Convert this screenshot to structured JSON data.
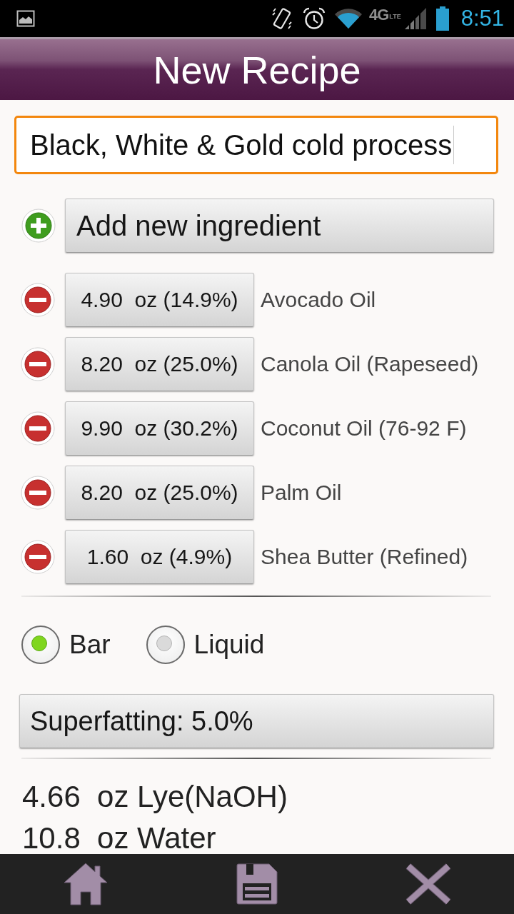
{
  "status_bar": {
    "network_label": "4G",
    "network_sub_label": "LTE",
    "time": "8:51"
  },
  "title_bar": {
    "title": "New Recipe"
  },
  "recipe_name": {
    "value": "Black, White & Gold cold process"
  },
  "add_button": {
    "label": "Add new ingredient"
  },
  "ingredients": [
    {
      "amount": "4.90  oz (14.9%)",
      "name": "Avocado Oil"
    },
    {
      "amount": "8.20  oz (25.0%)",
      "name": "Canola Oil (Rapeseed)"
    },
    {
      "amount": "9.90  oz (30.2%)",
      "name": "Coconut Oil (76-92 F)"
    },
    {
      "amount": "8.20  oz (25.0%)",
      "name": "Palm Oil"
    },
    {
      "amount": "1.60  oz (4.9%)",
      "name": "Shea Butter (Refined)"
    }
  ],
  "soap_type": [
    {
      "label": "Bar",
      "selected": true
    },
    {
      "label": "Liquid",
      "selected": false
    }
  ],
  "superfatting_button": {
    "label": "Superfatting: 5.0%"
  },
  "results": [
    "4.66  oz Lye(NaOH)",
    "10.8  oz Water"
  ]
}
